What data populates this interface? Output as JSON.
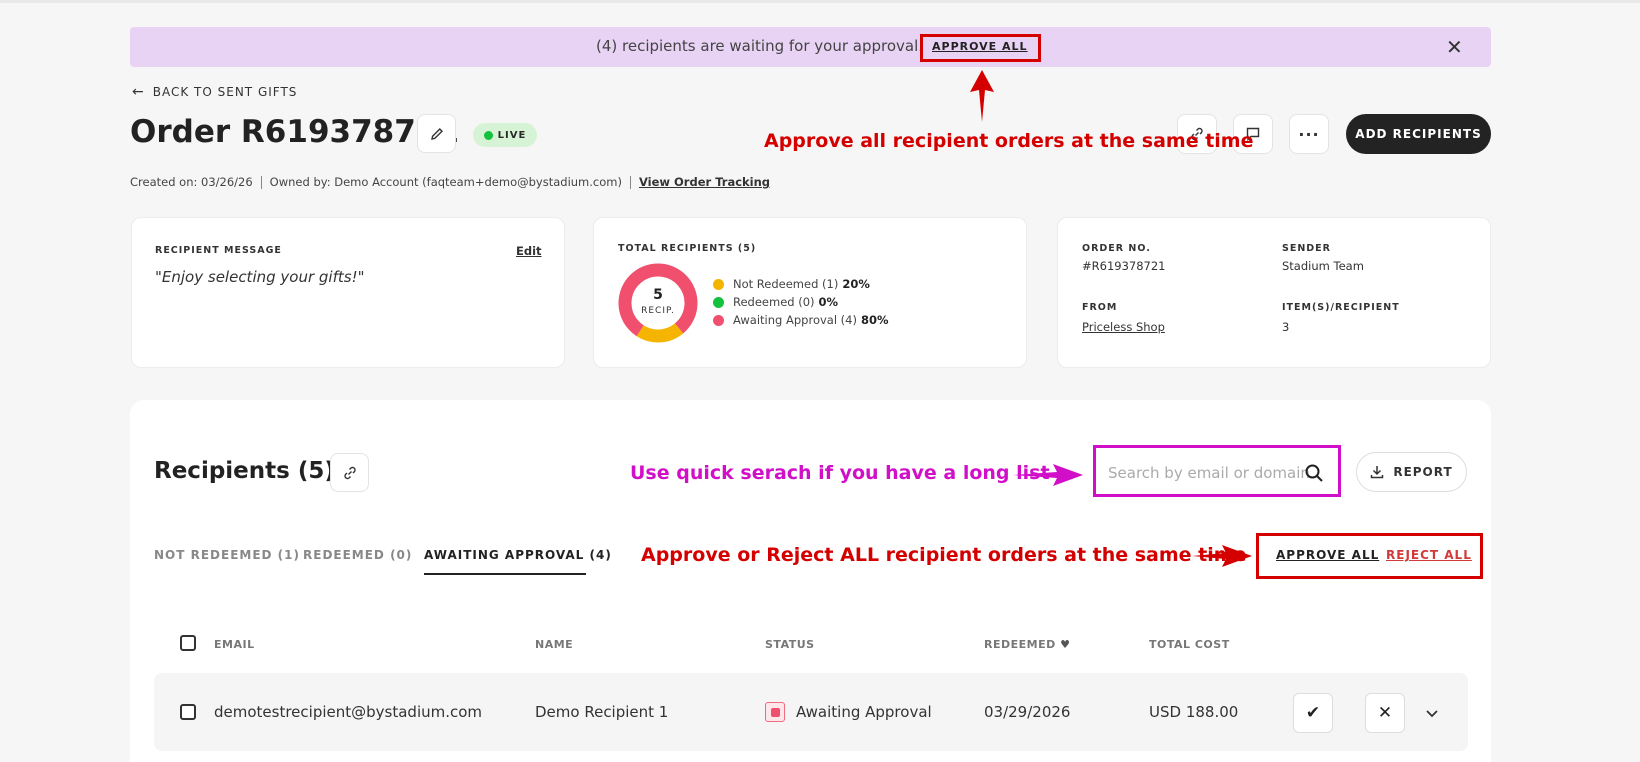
{
  "banner": {
    "message": "(4) recipients are waiting for your approval.",
    "approve_all": "APPROVE ALL",
    "close_icon": "close-icon"
  },
  "nav": {
    "back": "BACK TO SENT GIFTS"
  },
  "order": {
    "title": "Order R619378721",
    "status": "LIVE",
    "status_color": "#13c13d",
    "created": "Created on: 03/26/26",
    "owned": "Owned by: Demo Account (faqteam+demo@bystadium.com)",
    "tracking": "View Order Tracking",
    "add_recipients": "ADD RECIPIENTS"
  },
  "message_card": {
    "label": "RECIPIENT MESSAGE",
    "edit": "Edit",
    "text": "\"Enjoy selecting your gifts!\""
  },
  "totals_card": {
    "label": "TOTAL RECIPIENTS (5)",
    "donut_count": "5",
    "donut_unit": "RECIP.",
    "legend": [
      {
        "label": "Not Redeemed (1)",
        "pct": "20%",
        "color": "#f5b400",
        "value": 1
      },
      {
        "label": "Redeemed (0)",
        "pct": "0%",
        "color": "#13c13d",
        "value": 0
      },
      {
        "label": "Awaiting Approval (4)",
        "pct": "80%",
        "color": "#f0506d",
        "value": 4
      }
    ]
  },
  "info_card": {
    "order_no_label": "ORDER NO.",
    "order_no": "#R619378721",
    "sender_label": "SENDER",
    "sender": "Stadium Team",
    "from_label": "FROM",
    "from": "Priceless Shop",
    "items_label": "ITEM(S)/RECIPIENT",
    "items": "3"
  },
  "recipients": {
    "title": "Recipients (5)",
    "search_placeholder": "Search by email or domain",
    "report": "REPORT",
    "tabs": [
      "NOT REDEEMED (1)",
      "REDEEMED (0)",
      "AWAITING APPROVAL (4)"
    ],
    "approve_all": "APPROVE ALL",
    "reject_all": "REJECT ALL",
    "columns": [
      "EMAIL",
      "NAME",
      "STATUS",
      "REDEEMED",
      "TOTAL COST"
    ],
    "rows": [
      {
        "email": "demotestrecipient@bystadium.com",
        "name": "Demo Recipient 1",
        "status": "Awaiting Approval",
        "redeemed": "03/29/2026",
        "total": "USD 188.00"
      }
    ]
  },
  "annotations": {
    "approve_all_tip": "Approve all recipient orders at the same time",
    "search_tip": "Use quick serach if you have a long list",
    "bulk_tip": "Approve or Reject ALL recipient orders at the same time",
    "red": "#d40000",
    "magenta": "#d10fc8"
  }
}
